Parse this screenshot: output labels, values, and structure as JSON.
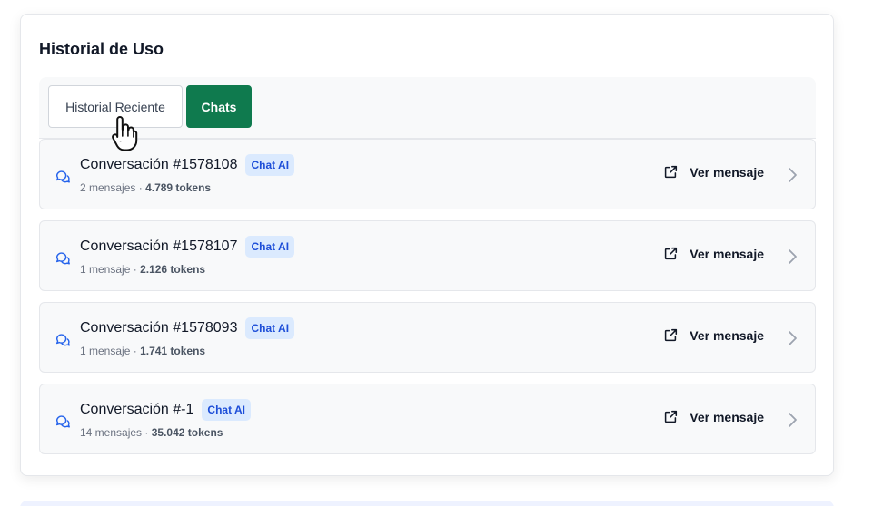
{
  "card": {
    "title": "Historial de Uso"
  },
  "tabs": [
    {
      "label": "Historial Reciente",
      "active": false
    },
    {
      "label": "Chats",
      "active": true
    }
  ],
  "items": [
    {
      "title": "Conversación #1578108",
      "badge": "Chat AI",
      "messages": "2 mensajes",
      "separator": "·",
      "tokens": "4.789 tokens",
      "action": "Ver mensaje"
    },
    {
      "title": "Conversación #1578107",
      "badge": "Chat AI",
      "messages": "1 mensaje",
      "separator": "·",
      "tokens": "2.126 tokens",
      "action": "Ver mensaje"
    },
    {
      "title": "Conversación #1578093",
      "badge": "Chat AI",
      "messages": "1 mensaje",
      "separator": "·",
      "tokens": "1.741 tokens",
      "action": "Ver mensaje"
    },
    {
      "title": "Conversación #-1",
      "badge": "Chat AI",
      "messages": "14 mensajes",
      "separator": "·",
      "tokens": "35.042 tokens",
      "action": "Ver mensaje"
    }
  ],
  "icons": {
    "item": "chat-bubbles-icon",
    "action": "external-link-icon",
    "chevron": "chevron-right-icon",
    "cursor": "hand-pointer-icon"
  },
  "colors": {
    "active_tab": "#0f7a4e",
    "badge_bg": "#dbeafe",
    "badge_text": "#1d4ed8",
    "icon_blue": "#2563eb"
  }
}
